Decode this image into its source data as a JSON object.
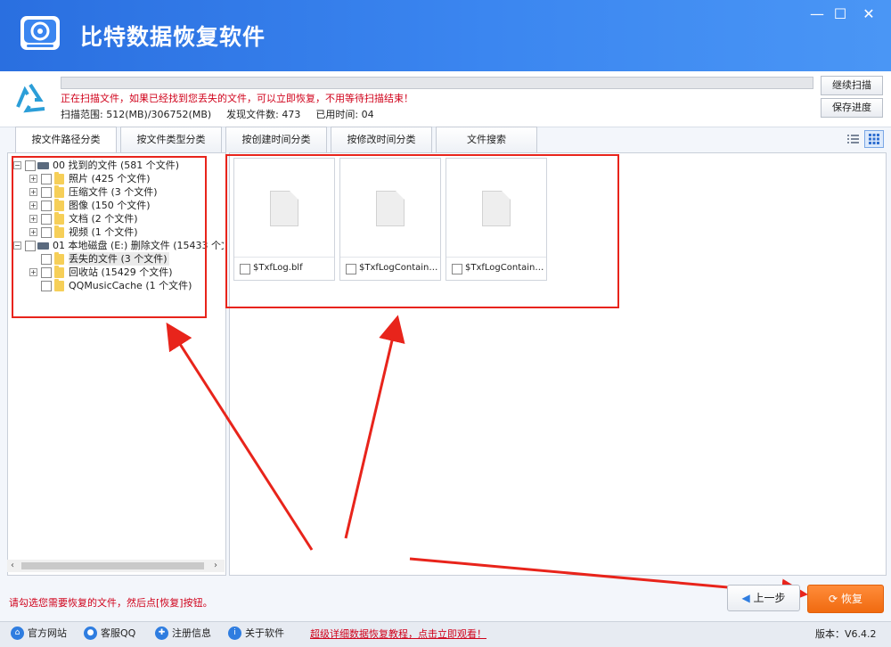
{
  "app": {
    "title": "比特数据恢复软件"
  },
  "window_controls": {
    "minimize": "—",
    "maximize": "☐",
    "close": "✕"
  },
  "scan": {
    "message": "正在扫描文件，如果已经找到您丢失的文件，可以立即恢复，不用等待扫描结束！",
    "range_label": "扫描范围:",
    "range_value": "512(MB)/306752(MB)",
    "found_label": "发现文件数:",
    "found_value": "473",
    "elapsed_label": "已用时间:",
    "elapsed_value": "04",
    "progress_fraction": 0.0
  },
  "buttons": {
    "continue_scan": "继续扫描",
    "save_progress": "保存进度",
    "prev": "上一步",
    "recover": "恢复"
  },
  "tabs": [
    {
      "label": "按文件路径分类"
    },
    {
      "label": "按文件类型分类"
    },
    {
      "label": "按创建时间分类"
    },
    {
      "label": "按修改时间分类"
    },
    {
      "label": "文件搜索"
    }
  ],
  "tree": [
    {
      "label": "00 找到的文件",
      "count": "(581 个文件)"
    },
    {
      "label": "照片",
      "count": "(425 个文件)"
    },
    {
      "label": "压缩文件",
      "count": "(3 个文件)"
    },
    {
      "label": "图像",
      "count": "(150 个文件)"
    },
    {
      "label": "文档",
      "count": "(2 个文件)"
    },
    {
      "label": "视频",
      "count": "(1 个文件)"
    },
    {
      "label": "01 本地磁盘 (E:) 删除文件",
      "count": "(15433 个文"
    },
    {
      "label": "丢失的文件",
      "count": "(3 个文件)"
    },
    {
      "label": "回收站",
      "count": "(15429 个文件)"
    },
    {
      "label": "QQMusicCache",
      "count": "(1 个文件)"
    }
  ],
  "files": [
    {
      "name": "$TxfLog.blf"
    },
    {
      "name": "$TxfLogContainer…"
    },
    {
      "name": "$TxfLogContainer…"
    }
  ],
  "hint": "请勾选您需要恢复的文件，然后点[恢复]按钮。",
  "footer": {
    "links": [
      {
        "label": "官方网站",
        "icon": "home-icon"
      },
      {
        "label": "客服QQ",
        "icon": "qq-icon"
      },
      {
        "label": "注册信息",
        "icon": "register-icon"
      },
      {
        "label": "关于软件",
        "icon": "info-icon"
      }
    ],
    "tutorial": "超级详细数据恢复教程，点击立即观看！",
    "version": "版本：V6.4.2"
  },
  "colors": {
    "title_bar": "#3b86f0",
    "annotation": "#e8241b",
    "recover_button": "#f06a10",
    "warning_text": "#d0021b"
  }
}
